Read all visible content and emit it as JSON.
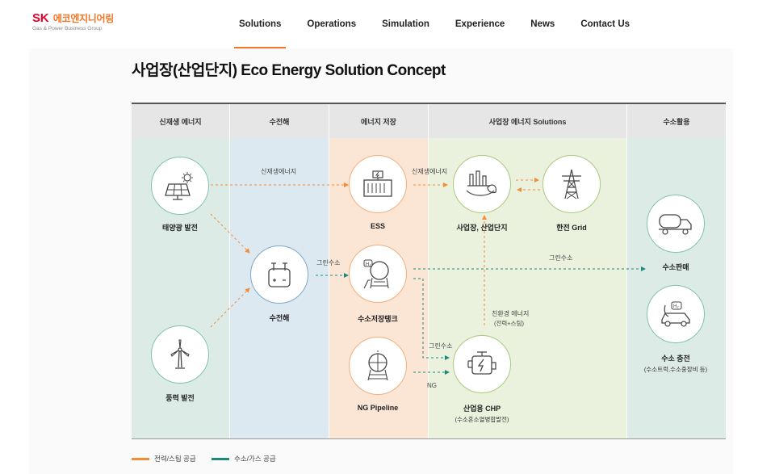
{
  "logo": {
    "brand": "SK",
    "brand_kr": "에코엔지니어링",
    "subtitle": "Gas & Power Business Group"
  },
  "nav": [
    {
      "label": "Solutions",
      "active": true
    },
    {
      "label": "Operations"
    },
    {
      "label": "Simulation"
    },
    {
      "label": "Experience"
    },
    {
      "label": "News"
    },
    {
      "label": "Contact Us"
    }
  ],
  "page_title": "사업장(산업단지) Eco Energy Solution Concept",
  "columns": [
    {
      "label": "신재생 에너지",
      "color": "#dcebe6"
    },
    {
      "label": "수전해",
      "color": "#dde9f1"
    },
    {
      "label": "에너지 저장",
      "color": "#fbe6d6"
    },
    {
      "label": "사업장 에너지 Solutions",
      "color": "#eaf2de"
    },
    {
      "label": "수소활용",
      "color": "#dcebe6"
    }
  ],
  "nodes": {
    "solar": "태양광 발전",
    "wind": "풍력 발전",
    "electrolysis": "수전해",
    "ess": "ESS",
    "h2tank": "수소저장탱크",
    "ngpipe": "NG Pipeline",
    "industrial": "사업장, 산업단지",
    "grid": "한전 Grid",
    "chp": "산업용 CHP",
    "chp_sub": "(수소혼소열병합발전)",
    "h2sale": "수소판매",
    "h2charge": "수소 충전",
    "h2charge_sub": "(수소트럭,수소중장비 등)"
  },
  "edges": {
    "renew1": "신재생에너지",
    "renew2": "신재생에너지",
    "green1": "그린수소",
    "green2": "그린수소",
    "green3": "그린수소",
    "ng": "NG",
    "eco": "친환경 에너지",
    "eco_sub": "(전력+스팀)"
  },
  "legend": [
    {
      "label": "전력/스팀 공급",
      "color": "#f28c38"
    },
    {
      "label": "수소/가스 공급",
      "color": "#1e8a7a"
    }
  ],
  "colors": {
    "orange": "#f28c38",
    "teal": "#1e8a7a",
    "accent": "#f47725"
  }
}
